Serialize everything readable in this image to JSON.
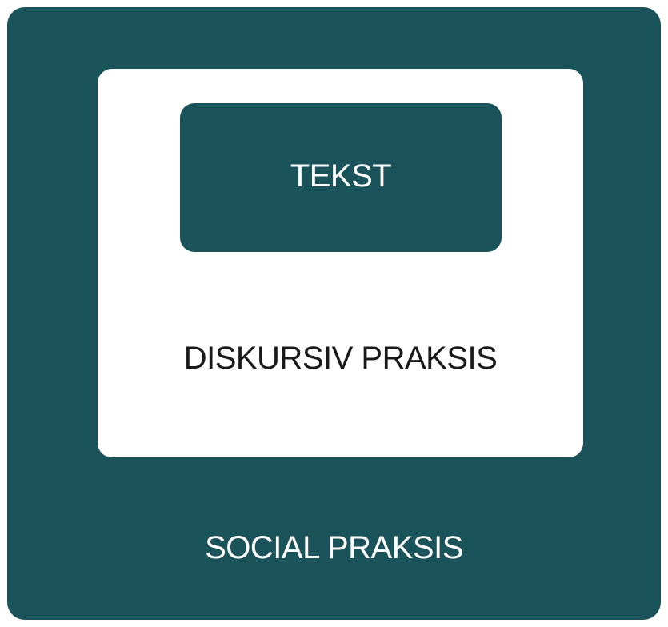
{
  "diagram": {
    "outer_label": "SOCIAL PRAKSIS",
    "middle_label": "DISKURSIV PRAKSIS",
    "inner_label": "TEKST",
    "colors": {
      "teal": "#1b535b",
      "white": "#ffffff",
      "text_dark": "#1a1a1a"
    }
  }
}
